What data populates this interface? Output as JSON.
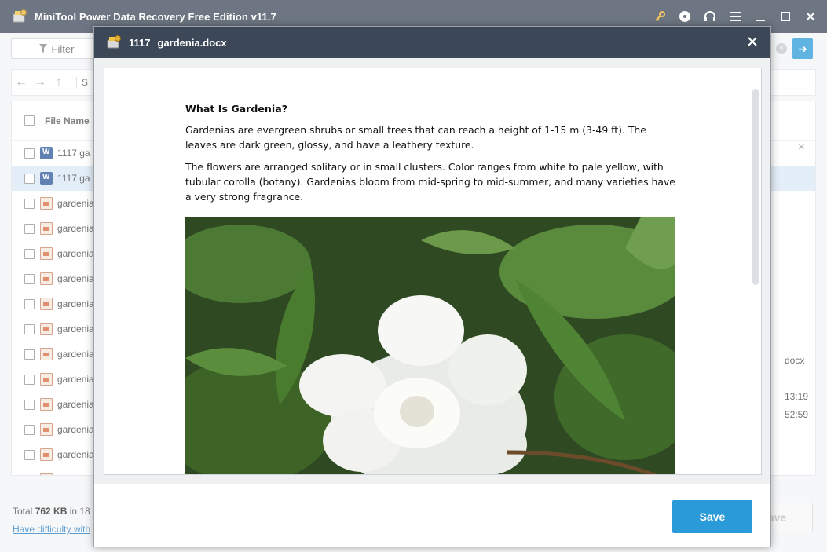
{
  "app": {
    "title": "MiniTool Power Data Recovery Free Edition v11.7",
    "controls": [
      "key-icon",
      "disc-icon",
      "headset-icon",
      "menu-icon",
      "minimize-icon",
      "maximize-icon",
      "close-icon"
    ]
  },
  "toolbar": {
    "filter_label": "Filter"
  },
  "nav": {
    "path_fragment": "S"
  },
  "file_list": {
    "header": "File Name",
    "rows": [
      {
        "name": "1117  ga",
        "type": "word"
      },
      {
        "name": "1117  ga",
        "type": "word",
        "selected": true
      },
      {
        "name": "gardenia",
        "type": "image"
      },
      {
        "name": "gardenia",
        "type": "image"
      },
      {
        "name": "gardenia",
        "type": "image"
      },
      {
        "name": "gardenia",
        "type": "image"
      },
      {
        "name": "gardenia",
        "type": "image"
      },
      {
        "name": "gardenia",
        "type": "image"
      },
      {
        "name": "gardenia",
        "type": "image"
      },
      {
        "name": "gardenia",
        "type": "image"
      },
      {
        "name": "gardenia",
        "type": "image"
      },
      {
        "name": "gardenia",
        "type": "image"
      },
      {
        "name": "gardenia",
        "type": "image"
      },
      {
        "name": "gardenia",
        "type": "image"
      }
    ]
  },
  "details": {
    "ext": "docx",
    "time1": "13:19",
    "time2": "52:59"
  },
  "status": {
    "prefix": "Total ",
    "size": "762 KB",
    "mid": " in 18 ",
    "help_link": "Have difficulty with "
  },
  "bg_save_label": "ave",
  "dialog": {
    "file_number": "1117",
    "file_name": "gardenia.docx",
    "save_label": "Save",
    "document": {
      "heading": "What Is Gardenia?",
      "paragraphs": [
        "Gardenias are evergreen shrubs or small trees that can reach a height of 1-15 m (3-49 ft). The leaves are dark green, glossy, and have a leathery texture.",
        "The flowers are arranged solitary or in small clusters. Color ranges from white to pale yellow, with tubular corolla (botany). Gardenias bloom from mid-spring to mid-summer, and many varieties have a very strong fragrance."
      ]
    }
  },
  "colors": {
    "titlebar": "#3c4858",
    "accent": "#2a9bd8",
    "selected_row": "#dbe8f6"
  }
}
